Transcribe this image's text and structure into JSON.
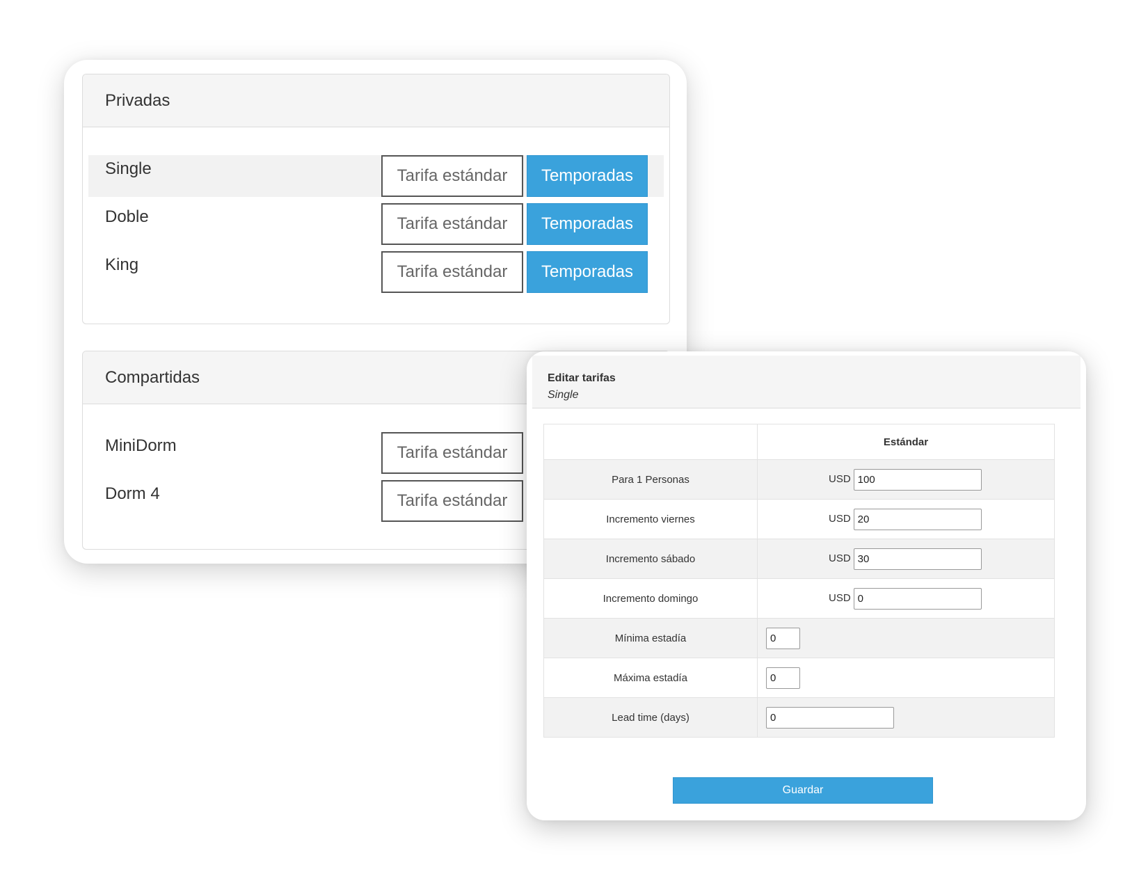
{
  "privadas": {
    "title": "Privadas",
    "rooms": [
      {
        "name": "Single",
        "tarifa_label": "Tarifa estándar",
        "temporadas_label": "Temporadas"
      },
      {
        "name": "Doble",
        "tarifa_label": "Tarifa estándar",
        "temporadas_label": "Temporadas"
      },
      {
        "name": "King",
        "tarifa_label": "Tarifa estándar",
        "temporadas_label": "Temporadas"
      }
    ]
  },
  "compartidas": {
    "title": "Compartidas",
    "rooms": [
      {
        "name": "MiniDorm",
        "tarifa_label": "Tarifa estándar"
      },
      {
        "name": "Dorm 4",
        "tarifa_label": "Tarifa estándar"
      }
    ]
  },
  "editor": {
    "title": "Editar tarifas",
    "subtitle": "Single",
    "column_header": "Estándar",
    "currency": "USD",
    "rows": [
      {
        "label": "Para 1 Personas",
        "value": "100"
      },
      {
        "label": "Incremento viernes",
        "value": "20"
      },
      {
        "label": "Incremento sábado",
        "value": "30"
      },
      {
        "label": "Incremento domingo",
        "value": "0"
      },
      {
        "label": "Mínima estadía",
        "value": "0"
      },
      {
        "label": "Máxima estadía",
        "value": "0"
      },
      {
        "label": "Lead time (days)",
        "value": "0"
      }
    ],
    "save_label": "Guardar"
  },
  "colors": {
    "accent": "#3aa2dc",
    "panel_header_bg": "#f5f5f5",
    "row_highlight": "#f2f2f2"
  }
}
